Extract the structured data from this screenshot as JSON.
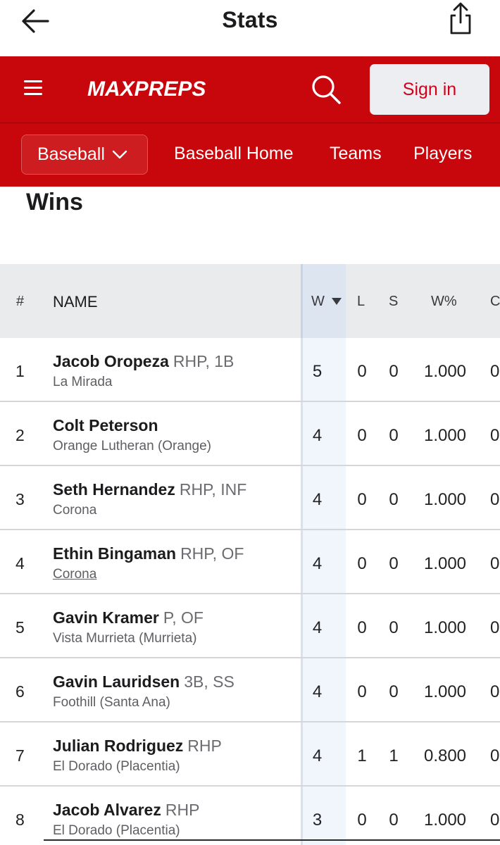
{
  "appbar": {
    "title": "Stats",
    "back_icon": "back-arrow-icon",
    "share_icon": "share-icon"
  },
  "header": {
    "brand": "MAXPREPS",
    "brand_color": "#c8070c",
    "signin_label": "Sign in",
    "sport_label": "Baseball",
    "nav": [
      "Baseball Home",
      "Teams",
      "Players"
    ]
  },
  "section_title": "Wins",
  "table": {
    "columns": [
      "#",
      "NAME",
      "W",
      "L",
      "S",
      "W%",
      "C"
    ],
    "sorted_column": "W",
    "sort_direction": "descending",
    "rows": [
      {
        "rank": "1",
        "name": "Jacob Oropeza",
        "pos": "RHP, 1B",
        "school": "La Mirada",
        "w": "5",
        "l": "0",
        "s": "0",
        "pct": "1.000",
        "next": "0"
      },
      {
        "rank": "2",
        "name": "Colt Peterson",
        "pos": "",
        "school": "Orange Lutheran (Orange)",
        "w": "4",
        "l": "0",
        "s": "0",
        "pct": "1.000",
        "next": "0"
      },
      {
        "rank": "3",
        "name": "Seth Hernandez",
        "pos": "RHP, INF",
        "school": "Corona",
        "w": "4",
        "l": "0",
        "s": "0",
        "pct": "1.000",
        "next": "0"
      },
      {
        "rank": "4",
        "name": "Ethin Bingaman",
        "pos": "RHP, OF",
        "school": "Corona",
        "w": "4",
        "l": "0",
        "s": "0",
        "pct": "1.000",
        "next": "0"
      },
      {
        "rank": "5",
        "name": "Gavin Kramer",
        "pos": "P, OF",
        "school": "Vista Murrieta (Murrieta)",
        "w": "4",
        "l": "0",
        "s": "0",
        "pct": "1.000",
        "next": "0"
      },
      {
        "rank": "6",
        "name": "Gavin Lauridsen",
        "pos": "3B, SS",
        "school": "Foothill (Santa Ana)",
        "w": "4",
        "l": "0",
        "s": "0",
        "pct": "1.000",
        "next": "0"
      },
      {
        "rank": "7",
        "name": "Julian Rodriguez",
        "pos": "RHP",
        "school": "El Dorado (Placentia)",
        "w": "4",
        "l": "1",
        "s": "1",
        "pct": "0.800",
        "next": "0"
      },
      {
        "rank": "8",
        "name": "Jacob Alvarez",
        "pos": "RHP",
        "school": "El Dorado (Placentia)",
        "w": "3",
        "l": "0",
        "s": "0",
        "pct": "1.000",
        "next": "0"
      }
    ]
  }
}
